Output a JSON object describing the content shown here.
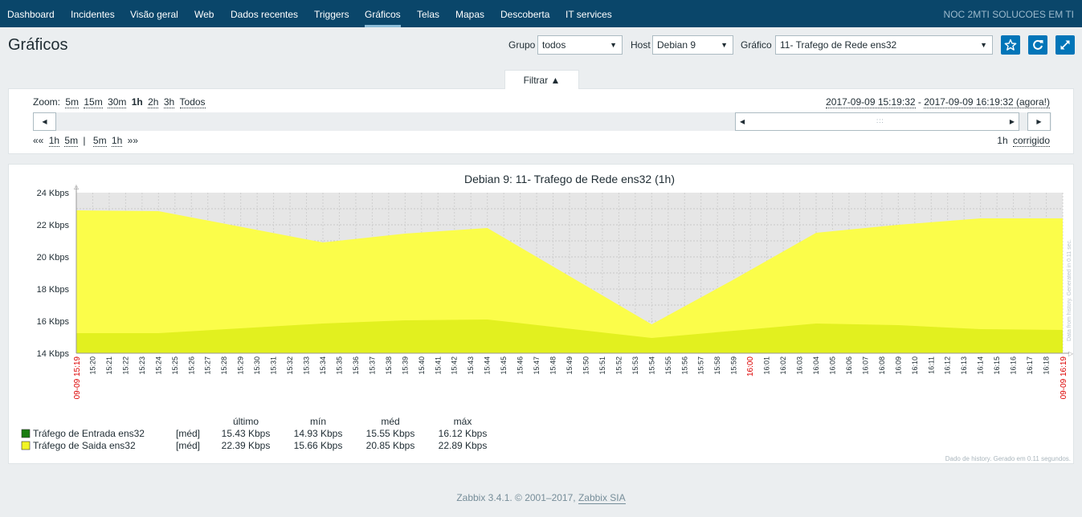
{
  "nav": {
    "items": [
      "Dashboard",
      "Incidentes",
      "Visão geral",
      "Web",
      "Dados recentes",
      "Triggers",
      "Gráficos",
      "Telas",
      "Mapas",
      "Descoberta",
      "IT services"
    ],
    "active": "Gráficos",
    "brand": "NOC 2MTI SOLUCOES EM TI"
  },
  "header": {
    "title": "Gráficos",
    "group_label": "Grupo",
    "group_value": "todos",
    "host_label": "Host",
    "host_value": "Debian 9",
    "graph_label": "Gráfico",
    "graph_value": "11- Trafego de Rede ens32",
    "icons": [
      "star-icon",
      "refresh-icon",
      "fullscreen-icon"
    ]
  },
  "filter": {
    "tab_label": "Filtrar ▲",
    "zoom_label": "Zoom:",
    "zoom_options": [
      "5m",
      "15m",
      "30m",
      "1h",
      "2h",
      "3h",
      "Todos"
    ],
    "zoom_selected": "1h",
    "period_start": "2017-09-09 15:19:32",
    "period_sep": " - ",
    "period_end": "2017-09-09 16:19:32 (agora!)",
    "nav_back": "««",
    "nav_back_links": [
      "1h",
      "5m"
    ],
    "nav_sep": "|",
    "nav_fwd_links": [
      "5m",
      "1h"
    ],
    "nav_fwd": "»»",
    "fixed_period": "1h",
    "fixed_label": "corrigido"
  },
  "colors": {
    "nav_bg": "#0a466a",
    "accent": "#0275b8",
    "series_in": "#e2f01f",
    "series_out": "#fbfd4a",
    "legend_in": "#1a7c11",
    "legend_out": "#f1f524",
    "red_label": "#dc0000"
  },
  "chart_data": {
    "type": "area",
    "title": "Debian 9: 11- Trafego de Rede ens32 (1h)",
    "ylabel": "",
    "yunit": "Kbps",
    "ylim": [
      14,
      24
    ],
    "yticks": [
      "14 Kbps",
      "16 Kbps",
      "18 Kbps",
      "20 Kbps",
      "22 Kbps",
      "24 Kbps"
    ],
    "x_start_label": "09-09 15:19",
    "x_end_label": "09-09 16:19",
    "x_highlight_label": "16:00",
    "x_labels": [
      "15:20",
      "15:21",
      "15:22",
      "15:23",
      "15:24",
      "15:25",
      "15:26",
      "15:27",
      "15:28",
      "15:29",
      "15:30",
      "15:31",
      "15:32",
      "15:33",
      "15:34",
      "15:35",
      "15:36",
      "15:37",
      "15:38",
      "15:39",
      "15:40",
      "15:41",
      "15:42",
      "15:43",
      "15:44",
      "15:45",
      "15:46",
      "15:47",
      "15:48",
      "15:49",
      "15:50",
      "15:51",
      "15:52",
      "15:53",
      "15:54",
      "15:55",
      "15:56",
      "15:57",
      "15:58",
      "15:59",
      "16:00",
      "16:01",
      "16:02",
      "16:03",
      "16:04",
      "16:05",
      "16:06",
      "16:07",
      "16:08",
      "16:09",
      "16:10",
      "16:11",
      "16:12",
      "16:13",
      "16:14",
      "16:15",
      "16:16",
      "16:17",
      "16:18",
      "16:19"
    ],
    "x_minutes": [
      0,
      5,
      15,
      20,
      25,
      35,
      40,
      45,
      50,
      55,
      60
    ],
    "series": [
      {
        "name": "Tráfego de Saida ens32",
        "values": [
          22.9,
          22.85,
          20.9,
          21.45,
          21.8,
          15.8,
          18.6,
          21.5,
          22.0,
          22.4,
          22.4
        ]
      },
      {
        "name": "Tráfego de Entrada ens32",
        "values": [
          15.25,
          15.25,
          15.85,
          16.05,
          16.1,
          14.95,
          15.4,
          15.85,
          15.75,
          15.5,
          15.45
        ]
      }
    ],
    "legend": {
      "headers": [
        "último",
        "mín",
        "méd",
        "máx"
      ],
      "rows": [
        {
          "name": "Tráfego de Entrada ens32",
          "func": "[méd]",
          "last": "15.43 Kbps",
          "min": "14.93 Kbps",
          "avg": "15.55 Kbps",
          "max": "16.12 Kbps"
        },
        {
          "name": "Tráfego de Saida ens32",
          "func": "[méd]",
          "last": "22.39 Kbps",
          "min": "15.66 Kbps",
          "avg": "20.85 Kbps",
          "max": "22.89 Kbps"
        }
      ]
    },
    "side_note": "Data from history. Generated in 0.11 sec.",
    "footer_note": "Dado de history. Gerado em 0.11 segundos."
  },
  "footer": {
    "text": "Zabbix 3.4.1. © 2001–2017, ",
    "link": "Zabbix SIA"
  }
}
